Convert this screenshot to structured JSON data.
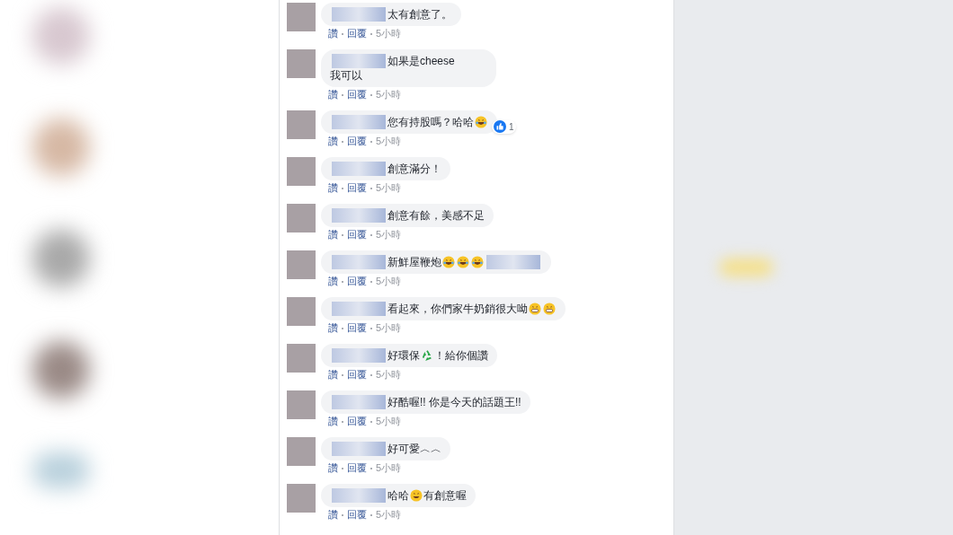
{
  "comments": [
    {
      "parts": [
        {
          "kind": "redacted"
        },
        {
          "kind": "text",
          "text": "太有創意了。"
        }
      ],
      "actions": [
        "讚",
        "回覆",
        "5小時"
      ]
    },
    {
      "parts": [
        {
          "kind": "redacted"
        },
        {
          "kind": "text",
          "text": "如果是cheese"
        },
        {
          "kind": "break"
        },
        {
          "kind": "text",
          "text": "我可以"
        }
      ],
      "actions": [
        "讚",
        "回覆",
        "5小時"
      ]
    },
    {
      "parts": [
        {
          "kind": "redacted"
        },
        {
          "kind": "text",
          "text": "您有持股嗎？哈哈"
        },
        {
          "kind": "laugh"
        }
      ],
      "actions": [
        "讚",
        "回覆",
        "5小時"
      ],
      "reaction_count": "1"
    },
    {
      "parts": [
        {
          "kind": "redacted"
        },
        {
          "kind": "text",
          "text": "創意滿分！"
        }
      ],
      "actions": [
        "讚",
        "回覆",
        "5小時"
      ]
    },
    {
      "parts": [
        {
          "kind": "redacted"
        },
        {
          "kind": "text",
          "text": "創意有餘，美感不足"
        }
      ],
      "actions": [
        "讚",
        "回覆",
        "5小時"
      ]
    },
    {
      "parts": [
        {
          "kind": "redacted"
        },
        {
          "kind": "text",
          "text": "新鮮屋鞭炮"
        },
        {
          "kind": "laugh"
        },
        {
          "kind": "laugh"
        },
        {
          "kind": "laugh"
        },
        {
          "kind": "redacted"
        }
      ],
      "actions": [
        "讚",
        "回覆",
        "5小時"
      ]
    },
    {
      "parts": [
        {
          "kind": "redacted"
        },
        {
          "kind": "text",
          "text": "看起來，你們家牛奶銷很大呦"
        },
        {
          "kind": "grin"
        },
        {
          "kind": "grin"
        }
      ],
      "actions": [
        "讚",
        "回覆",
        "5小時"
      ]
    },
    {
      "parts": [
        {
          "kind": "redacted"
        },
        {
          "kind": "text",
          "text": "好環保"
        },
        {
          "kind": "recycle"
        },
        {
          "kind": "text",
          "text": "！給你個讚"
        }
      ],
      "actions": [
        "讚",
        "回覆",
        "5小時"
      ]
    },
    {
      "parts": [
        {
          "kind": "redacted"
        },
        {
          "kind": "text",
          "text": "好酷喔!! 你是今天的話題王!!"
        }
      ],
      "actions": [
        "讚",
        "回覆",
        "5小時"
      ]
    },
    {
      "parts": [
        {
          "kind": "redacted"
        },
        {
          "kind": "text",
          "text": "好可愛︿︿"
        }
      ],
      "actions": [
        "讚",
        "回覆",
        "5小時"
      ]
    },
    {
      "parts": [
        {
          "kind": "redacted"
        },
        {
          "kind": "text",
          "text": "哈哈"
        },
        {
          "kind": "smile"
        },
        {
          "kind": "text",
          "text": "有創意喔"
        }
      ],
      "actions": [
        "讚",
        "回覆",
        "5小時"
      ]
    }
  ]
}
